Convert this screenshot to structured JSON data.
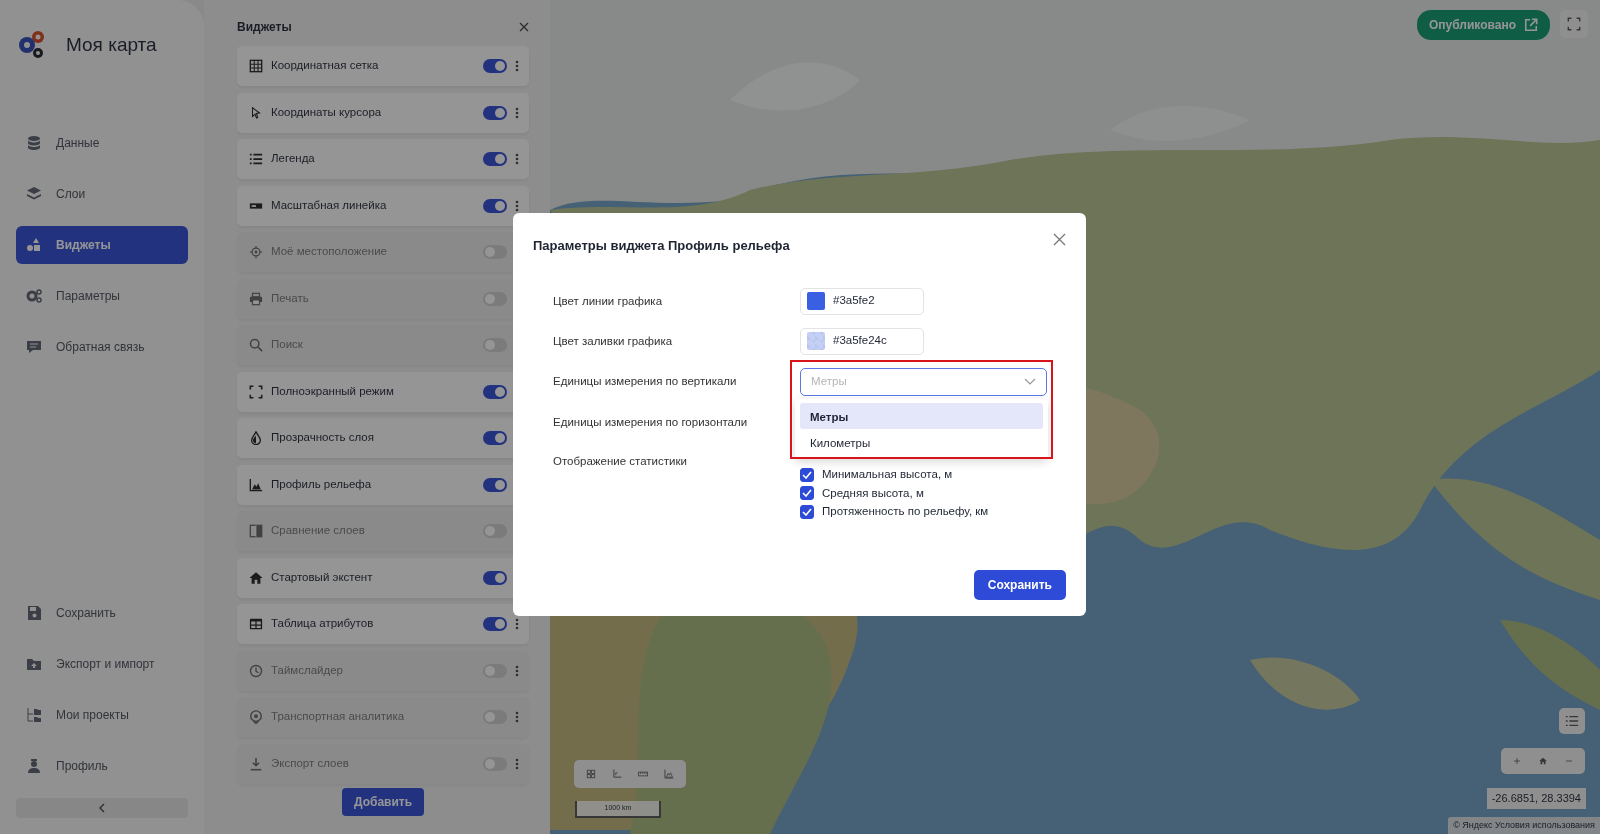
{
  "app": {
    "title": "Моя карта"
  },
  "sidebar": {
    "items": [
      {
        "label": "Данные",
        "selected": false
      },
      {
        "label": "Слои",
        "selected": false
      },
      {
        "label": "Виджеты",
        "selected": true
      },
      {
        "label": "Параметры",
        "selected": false
      },
      {
        "label": "Обратная связь",
        "selected": false
      }
    ],
    "bottom_items": [
      {
        "label": "Сохранить"
      },
      {
        "label": "Экспорт и импорт"
      },
      {
        "label": "Мои проекты"
      },
      {
        "label": "Профиль"
      }
    ]
  },
  "widgets_panel": {
    "title": "Виджеты",
    "items": [
      {
        "label": "Координатная сетка",
        "on": true
      },
      {
        "label": "Координаты курсора",
        "on": true
      },
      {
        "label": "Легенда",
        "on": true
      },
      {
        "label": "Масштабная линейка",
        "on": true
      },
      {
        "label": "Моё местоположение",
        "on": false
      },
      {
        "label": "Печать",
        "on": false
      },
      {
        "label": "Поиск",
        "on": false
      },
      {
        "label": "Полноэкранный режим",
        "on": true
      },
      {
        "label": "Прозрачность слоя",
        "on": true
      },
      {
        "label": "Профиль рельефа",
        "on": true
      },
      {
        "label": "Сравнение слоев",
        "on": false
      },
      {
        "label": "Стартовый экстент",
        "on": true
      },
      {
        "label": "Таблица атрибутов",
        "on": true
      },
      {
        "label": "Таймслайдер",
        "on": false
      },
      {
        "label": "Транспортная аналитика",
        "on": false
      },
      {
        "label": "Экспорт слоев",
        "on": false
      }
    ],
    "add_button": "Добавить"
  },
  "map": {
    "publish_button": "Опубликовано",
    "scale_label": "1000 km",
    "coordinates": "-26.6851, 28.3394",
    "attribution": "© Яндекс Условия использования"
  },
  "dialog": {
    "title": "Параметры виджета Профиль рельефа",
    "fields": [
      {
        "kind": "color",
        "label": "Цвет линии графика",
        "value": "#3a5fe2"
      },
      {
        "kind": "color",
        "label": "Цвет заливки графика",
        "value": "#3a5fe24c"
      },
      {
        "kind": "select",
        "label": "Единицы измерения по вертикали",
        "placeholder": "Метры",
        "open": true,
        "options": [
          {
            "label": "Метры",
            "selected": true
          },
          {
            "label": "Километры",
            "selected": false
          }
        ]
      },
      {
        "kind": "select",
        "label": "Единицы измерения по горизонтали"
      },
      {
        "kind": "checklist",
        "label": "Отображение статистики",
        "items": [
          {
            "label": "Минимальная высота, м",
            "checked": true
          },
          {
            "label": "Средняя высота, м",
            "checked": true
          },
          {
            "label": "Протяженность по рельефу, км",
            "checked": true
          }
        ]
      }
    ],
    "save_button": "Сохранить"
  }
}
